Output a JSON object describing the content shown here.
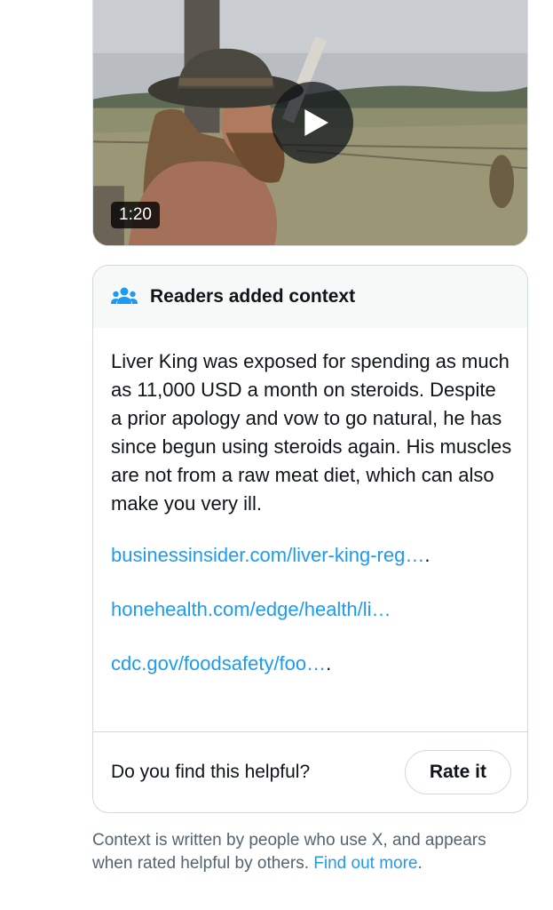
{
  "video": {
    "duration": "1:20",
    "play_icon": "play-icon",
    "thumbnail": "man-in-cowboy-hat-holding-bone-in-field"
  },
  "note": {
    "header_icon": "people-icon",
    "title": "Readers added context",
    "text": "Liver King was exposed for spending as much as 11,000 USD a month on steroids. Despite a prior apology and vow to go natural, he has since begun using steroids again. His muscles are not from a raw meat diet, which can also make you very ill.",
    "links": [
      {
        "label": "businessinsider.com/liver-king-reg…",
        "trail": "."
      },
      {
        "label": "honehealth.com/edge/health/li…",
        "trail": ""
      },
      {
        "label": "cdc.gov/foodsafety/foo…",
        "trail": "."
      }
    ],
    "helpful_question": "Do you find this helpful?",
    "rate_label": "Rate it"
  },
  "disclaimer": {
    "text": "Context is written by people who use X, and appears when rated helpful by others.",
    "link_label": "Find out more",
    "trail": "."
  },
  "colors": {
    "accent": "#1d9bf0",
    "text": "#0f1419",
    "muted": "#536471",
    "border": "#cfd9de",
    "header_bg": "#f7f9f9"
  }
}
